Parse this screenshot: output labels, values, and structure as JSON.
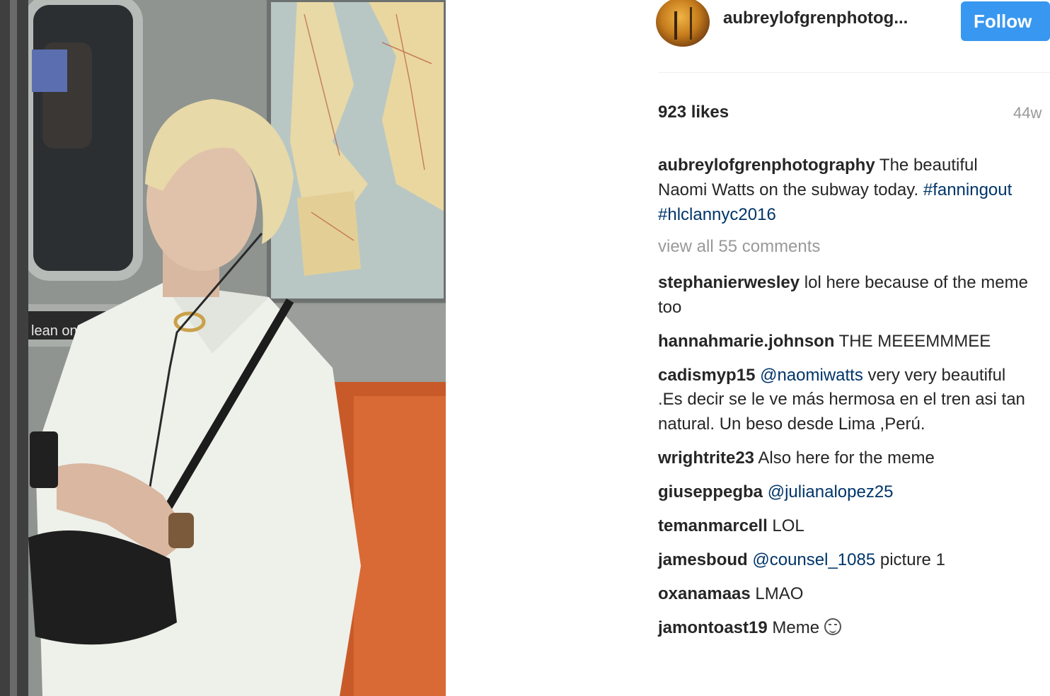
{
  "post": {
    "image_alt": "Woman with blonde hair in white shirt sitting on subway using phone",
    "poster_sign_text": "lean on do"
  },
  "header": {
    "username": "aubreylofgrenphotog...",
    "follow_label": "Follow",
    "avatar_icon": "profile-avatar"
  },
  "stats": {
    "likes": "923 likes",
    "time": "44w"
  },
  "caption": {
    "user": "aubreylofgrenphotography",
    "text": " The beautiful Naomi Watts on the subway today. ",
    "tags": [
      "#fanningout",
      "#hlclannyc2016"
    ]
  },
  "view_all": "view all 55 comments",
  "comments": [
    {
      "user": "stephanierwesley",
      "mention": "",
      "text": " lol here because of the meme too"
    },
    {
      "user": "hannahmarie.johnson",
      "mention": "",
      "text": " THE MEEEMMMEE"
    },
    {
      "user": "cadismyp15",
      "mention": "@naomiwatts",
      "text": " very very beautiful .Es decir se le ve más hermosa en el tren asi tan natural. Un beso desde Lima ,Perú."
    },
    {
      "user": "wrightrite23",
      "mention": "",
      "text": " Also here for the meme"
    },
    {
      "user": "giuseppegba",
      "mention": "@julianalopez25",
      "text": ""
    },
    {
      "user": "temanmarcell",
      "mention": "",
      "text": " LOL"
    },
    {
      "user": "jamesboud",
      "mention": "@counsel_1085",
      "text": " picture 1"
    },
    {
      "user": "oxanamaas",
      "mention": "",
      "text": " LMAO"
    },
    {
      "user": "jamontoast19",
      "mention": "",
      "text": " Meme ",
      "emoji": "laughing-emoji-icon"
    }
  ],
  "colors": {
    "follow_button": "#3897f0",
    "link": "#003569",
    "muted": "#999999",
    "text": "#262626"
  }
}
